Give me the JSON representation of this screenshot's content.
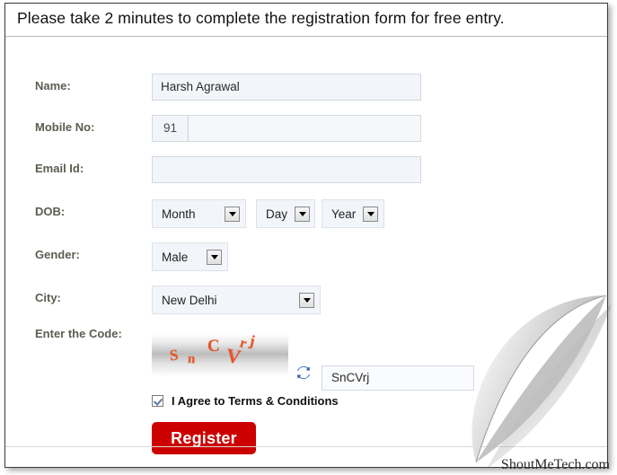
{
  "header": {
    "text": "Please take 2 minutes to complete the registration form for free entry."
  },
  "form": {
    "rows": [
      {
        "label": "Name:"
      },
      {
        "label": "Mobile No:"
      },
      {
        "label": "Email Id:"
      },
      {
        "label": "DOB:"
      },
      {
        "label": "Gender:"
      },
      {
        "label": "City:"
      },
      {
        "label": "Enter the Code:"
      }
    ],
    "name": {
      "label": "Name:",
      "value": "Harsh Agrawal",
      "placeholder": ""
    },
    "mobile": {
      "label": "Mobile No:",
      "country_code": "91",
      "value": "",
      "placeholder": ""
    },
    "email": {
      "label": "Email Id:",
      "value": "",
      "placeholder": ""
    },
    "dob": {
      "label": "DOB:",
      "month": {
        "value": "Month",
        "options": [
          "Month"
        ]
      },
      "day": {
        "value": "Day",
        "options": [
          "Day"
        ]
      },
      "year": {
        "value": "Year",
        "options": [
          "Year"
        ]
      }
    },
    "gender": {
      "label": "Gender:",
      "value": "Male",
      "options": [
        "Male"
      ]
    },
    "city": {
      "label": "City:",
      "value": "New Delhi",
      "options": [
        "New Delhi"
      ]
    },
    "captcha": {
      "label": "Enter the Code:",
      "image_text": "SnCVrj",
      "characters": [
        "S",
        "n",
        "C",
        "V",
        "r",
        "j"
      ],
      "input_value": "SnCVrj",
      "placeholder": "",
      "refresh_icon": "refresh-icon",
      "text_color": "#e8552a"
    },
    "agree": {
      "label": "I Agree to Terms & Conditions",
      "checked": true
    },
    "submit": {
      "label": "Register",
      "color": "#cc0000"
    }
  },
  "watermark": {
    "text": "ShoutMeTech.com"
  }
}
